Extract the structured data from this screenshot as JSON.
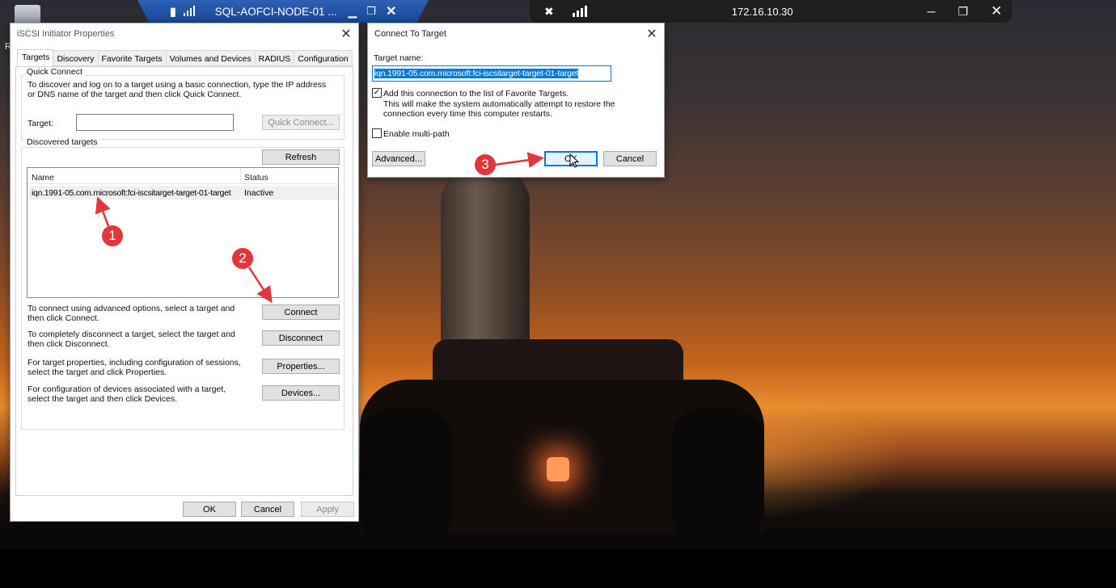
{
  "remote_toolbar": {
    "title": "SQL-AOFCI-NODE-01 ...",
    "pin_icon": "pin-icon",
    "signal_icon": "signal-icon"
  },
  "remote_desktop_bar": {
    "address": "172.16.10.30"
  },
  "desktop_icon_label": "R",
  "iscsi": {
    "title": "iSCSI Initiator Properties",
    "tabs": [
      "Targets",
      "Discovery",
      "Favorite Targets",
      "Volumes and Devices",
      "RADIUS",
      "Configuration"
    ],
    "quick_connect": {
      "legend": "Quick Connect",
      "description": "To discover and log on to a target using a basic connection, type the IP address or DNS name of the target and then click Quick Connect.",
      "target_label": "Target:",
      "target_value": "",
      "button": "Quick Connect..."
    },
    "discovered": {
      "legend": "Discovered targets",
      "refresh": "Refresh",
      "columns": [
        "Name",
        "Status"
      ],
      "rows": [
        {
          "name": "iqn.1991-05.com.microsoft:fci-iscsitarget-target-01-target",
          "status": "Inactive"
        }
      ]
    },
    "actions": [
      {
        "text": "To connect using advanced options, select a target and then click Connect.",
        "button": "Connect"
      },
      {
        "text": "To completely disconnect a target, select the target and then click Disconnect.",
        "button": "Disconnect"
      },
      {
        "text": "For target properties, including configuration of sessions, select the target and click Properties.",
        "button": "Properties..."
      },
      {
        "text": "For configuration of devices associated with a target, select the target and then click Devices.",
        "button": "Devices..."
      }
    ],
    "footer": {
      "ok": "OK",
      "cancel": "Cancel",
      "apply": "Apply"
    }
  },
  "connect": {
    "title": "Connect To Target",
    "target_name_label": "Target name:",
    "target_name_value": "iqn.1991-05.com.microsoft:fci-iscsitarget-target-01-target",
    "favorites_checkbox": {
      "checked": true,
      "label": "Add this connection to the list of Favorite Targets.",
      "detail": "This will make the system automatically attempt to restore the connection every time this computer restarts."
    },
    "multipath_checkbox": {
      "checked": false,
      "label": "Enable multi-path"
    },
    "advanced": "Advanced...",
    "ok": "OK",
    "cancel": "Cancel"
  },
  "annotations": {
    "marker_1": "1",
    "marker_2": "2",
    "marker_3": "3",
    "color": "#e0373a"
  }
}
